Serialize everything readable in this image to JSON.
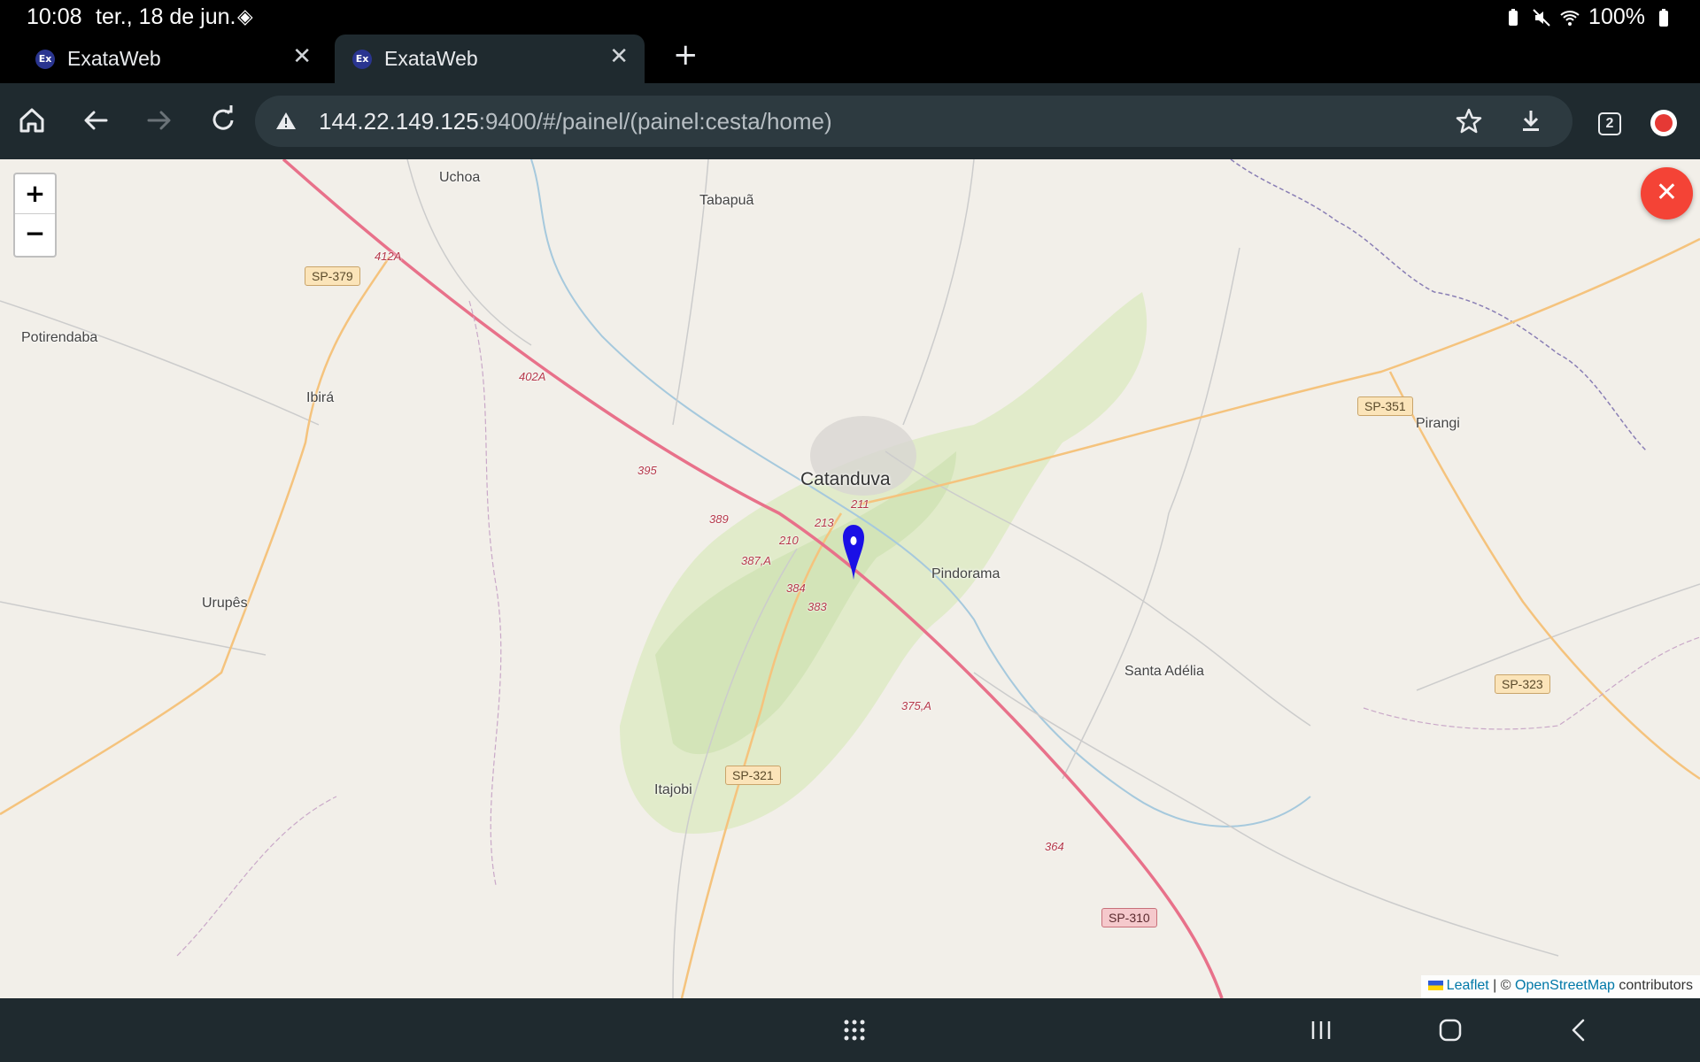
{
  "status": {
    "time": "10:08",
    "date": "ter., 18 de jun.",
    "battery": "100%"
  },
  "tabs": [
    {
      "favicon": "Ex",
      "title": "ExataWeb",
      "active": false
    },
    {
      "favicon": "Ex",
      "title": "ExataWeb",
      "active": true
    }
  ],
  "toolbar": {
    "url_host": "144.22.149.125",
    "url_path": ":9400/#/painel/(painel:cesta/home)",
    "tab_count": "2"
  },
  "map": {
    "zoom_in": "+",
    "zoom_out": "−",
    "close": "✕",
    "places": {
      "uchoa": "Uchoa",
      "tabapua": "Tabapuã",
      "potirendaba": "Potirendaba",
      "ibira": "Ibirá",
      "catanduva": "Catanduva",
      "pirangi": "Pirangi",
      "pindorama": "Pindorama",
      "urupes": "Urupês",
      "santa_adelia": "Santa Adélia",
      "itajobi": "Itajobi"
    },
    "shields": {
      "sp379": "SP-379",
      "sp351": "SP-351",
      "sp323": "SP-323",
      "sp321": "SP-321",
      "sp310": "SP-310"
    },
    "km_markers": {
      "k412a": "412A",
      "k402a": "402A",
      "k395": "395",
      "k389": "389",
      "k387a": "387,A",
      "k384": "384",
      "k383": "383",
      "k375a": "375,A",
      "k364": "364",
      "k213": "213",
      "k211": "211",
      "k210": "210"
    },
    "attribution": {
      "leaflet": "Leaflet",
      "sep": " | © ",
      "osm": "OpenStreetMap",
      "contributors": " contributors"
    }
  }
}
